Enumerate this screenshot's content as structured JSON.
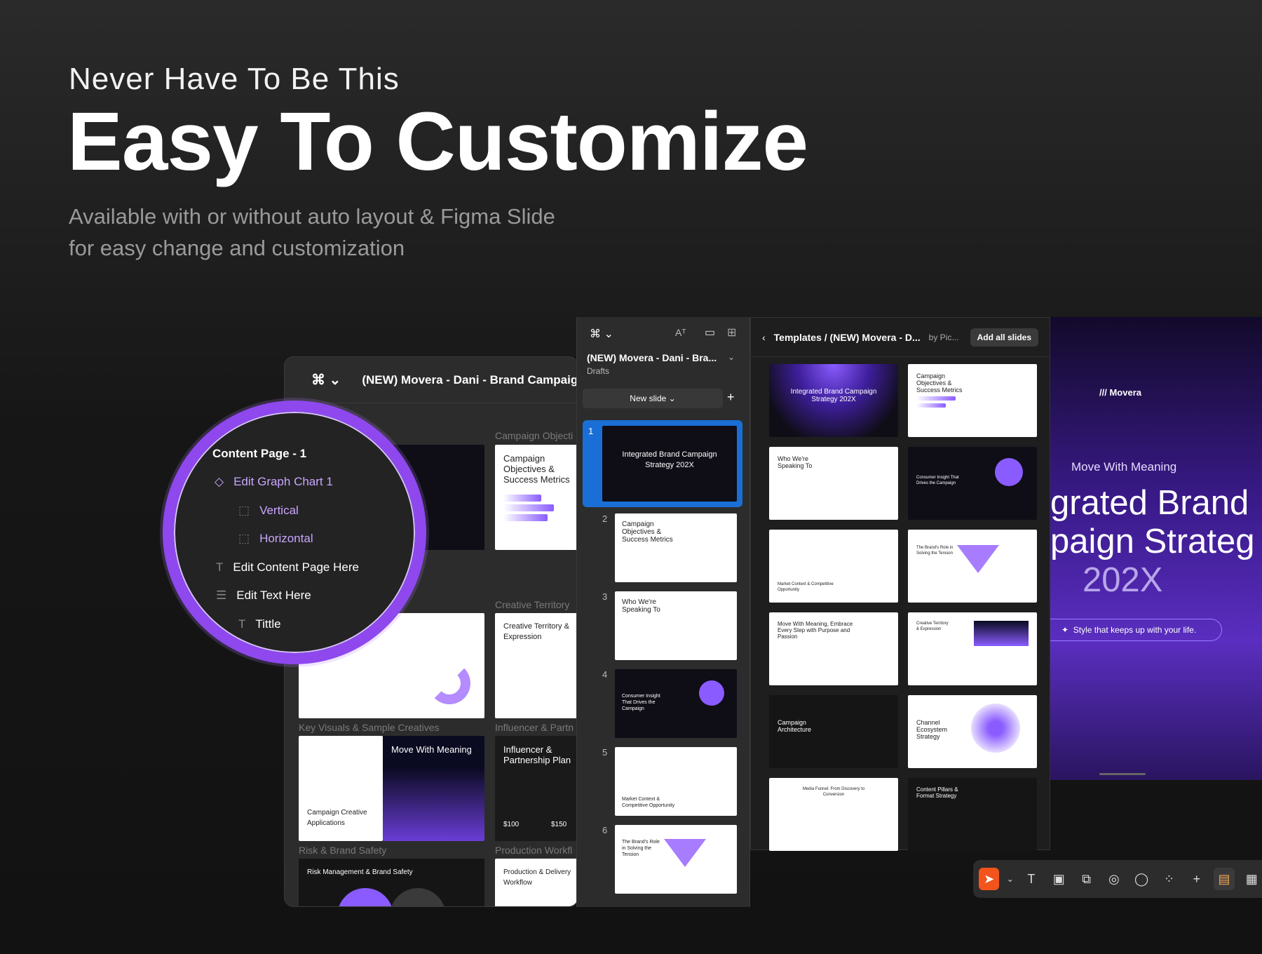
{
  "hero": {
    "subtitle": "Never Have To Be This",
    "title": "Easy To Customize",
    "desc_line1": "Available with or without auto layout  & Figma Slide",
    "desc_line2": "for easy change and customization"
  },
  "back_window": {
    "title": "(NEW) Movera - Dani - Brand Campaign S",
    "sections": [
      "Campaign Objecti",
      "Creative Territory",
      "Key Visuals & Sample Creatives",
      "Influencer & Partn",
      "Risk & Brand Safety",
      "Production Workfl"
    ],
    "slides": {
      "objectives": "Campaign Objectives & Success Metrics",
      "territory": "Creative Territory & Expression",
      "move": "Move With Meaning",
      "applications": "Campaign Creative Applications",
      "influencer": "Influencer & Partnership Plan",
      "risk": "Risk Management & Brand Safety",
      "production": "Production & Delivery Workflow",
      "price": "$100",
      "price2": "$150"
    }
  },
  "layers": {
    "content_page": "Content Page - 1",
    "graph": "Edit Graph Chart 1",
    "vertical": "Vertical",
    "horizontal": "Horizontal",
    "content_here": "Edit Content Page Here",
    "text_here": "Edit Text Here",
    "title": "Tittle"
  },
  "mid_panel": {
    "file": "(NEW) Movera - Dani - Bra...",
    "drafts": "Drafts",
    "new_slide": "New slide",
    "thumbs": [
      {
        "num": "1",
        "title": "Integrated Brand Campaign Strategy 202X"
      },
      {
        "num": "2",
        "title": "Campaign Objectives & Success Metrics"
      },
      {
        "num": "3",
        "title": "Who We're Speaking To"
      },
      {
        "num": "4",
        "title": "Consumer Insight That Drives the Campaign"
      },
      {
        "num": "5",
        "title": "Market Context & Competitive Opportunity"
      },
      {
        "num": "6",
        "title": "The Brand's Role in Solving the Tension"
      }
    ]
  },
  "templates": {
    "path": "Templates / (NEW) Movera - D...",
    "by": "by Pic...",
    "add_all": "Add all slides",
    "cards": [
      "Integrated Brand Campaign Strategy 202X",
      "Campaign Objectives & Success Metrics",
      "Who We're Speaking To",
      "Consumer Insight That Drives the Campaign",
      "Market Context & Competitive Opportunity",
      "The Brand's Role in Solving the Tension",
      "Move With Meaning, Embrace Every Step with Purpose and Passion",
      "Creative Territory & Expression",
      "Campaign Architecture",
      "Channel Ecosystem Strategy",
      "Media Funnel: From Discovery to Conversion",
      "Content Pillars & Format Strategy"
    ]
  },
  "preview": {
    "brand": "Movera",
    "kicker": "Move With Meaning",
    "line1": "grated Brand",
    "line2": "paign Strateg",
    "year": "202X",
    "tagline": "Style that keeps up with your life."
  },
  "colors": {
    "accent": "#8e48ee",
    "toolbar_active": "#f2541b",
    "selected": "#1a6fd6"
  }
}
